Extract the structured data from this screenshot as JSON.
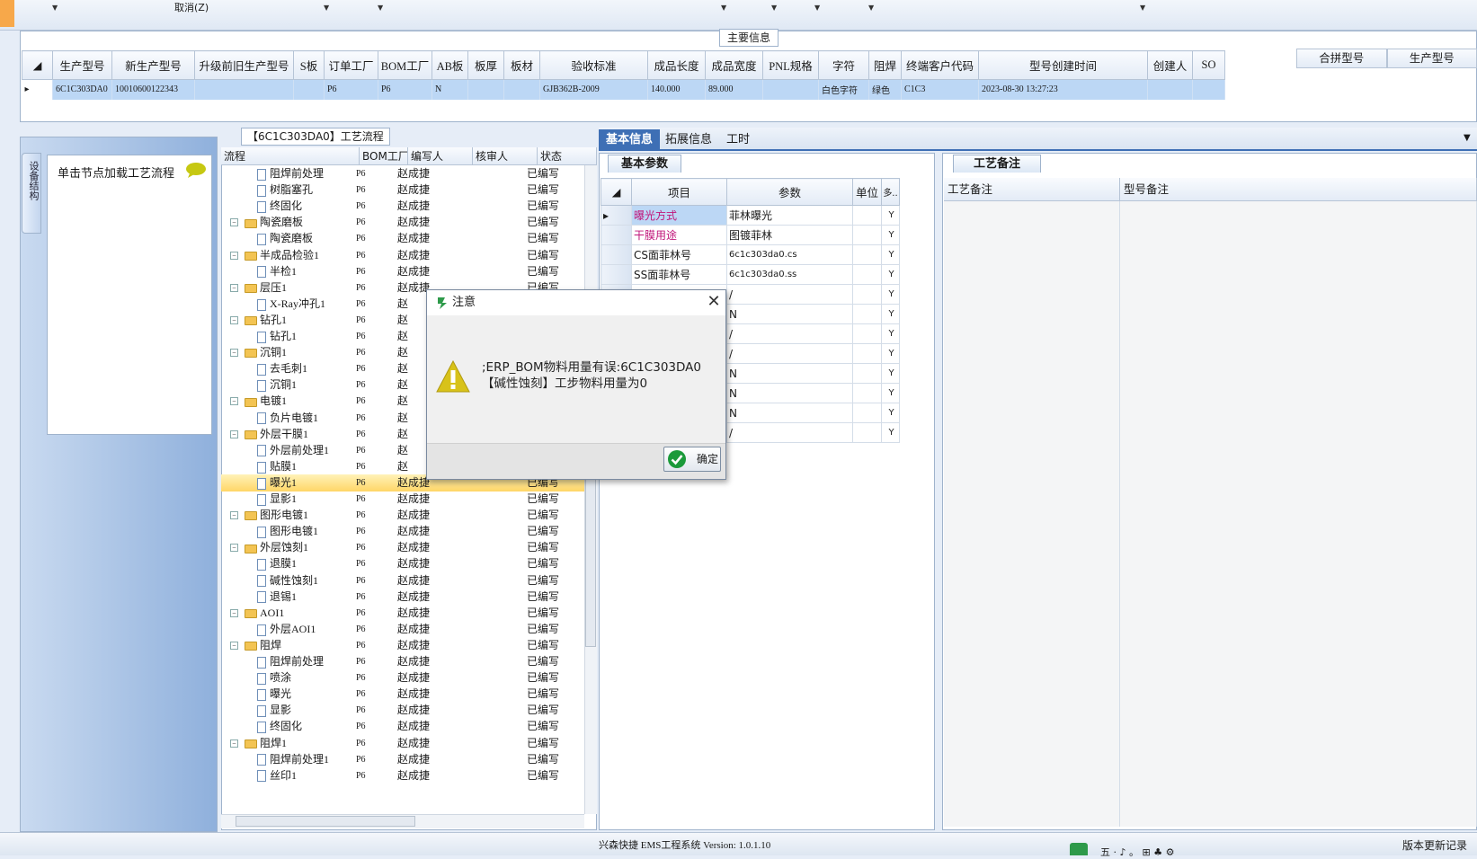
{
  "toolbar": {
    "cancel": "取消(Z)"
  },
  "main_info": {
    "title": "主要信息",
    "columns": [
      "生产型号",
      "新生产型号",
      "升级前旧生产型号",
      "S板",
      "订单工厂",
      "BOM工厂",
      "AB板",
      "板厚",
      "板材",
      "验收标准",
      "成品长度",
      "成品宽度",
      "PNL规格",
      "字符",
      "阻焊",
      "终端客户代码",
      "型号创建时间",
      "创建人",
      "SO"
    ],
    "row": [
      "6C1C303DA0",
      "10010600122343",
      "",
      "",
      "P6",
      "P6",
      "N",
      "",
      "",
      "GJB362B-2009",
      "140.000",
      "89.000",
      "",
      "白色字符",
      "绿色",
      "C1C3",
      "2023-08-30 13:27:23",
      "",
      ""
    ],
    "merge_columns": [
      "合拼型号",
      "生产型号"
    ]
  },
  "left_panel": {
    "vertical_tab": "设备结构",
    "load_label": "单击节点加载工艺流程"
  },
  "tree": {
    "title": "【6C1C303DA0】工艺流程",
    "columns": [
      "流程",
      "BOM工厂",
      "编写人",
      "核审人",
      "状态"
    ],
    "rows": [
      {
        "level": 2,
        "name": "阻焊前处理",
        "factory": "P6",
        "author": "赵成捷",
        "status": "已编写",
        "type": "file"
      },
      {
        "level": 2,
        "name": "树脂塞孔",
        "factory": "P6",
        "author": "赵成捷",
        "status": "已编写",
        "type": "file"
      },
      {
        "level": 2,
        "name": "终固化",
        "factory": "P6",
        "author": "赵成捷",
        "status": "已编写",
        "type": "file"
      },
      {
        "level": 1,
        "name": "陶瓷磨板",
        "factory": "P6",
        "author": "赵成捷",
        "status": "已编写",
        "type": "folder"
      },
      {
        "level": 2,
        "name": "陶瓷磨板",
        "factory": "P6",
        "author": "赵成捷",
        "status": "已编写",
        "type": "file"
      },
      {
        "level": 1,
        "name": "半成品检验1",
        "factory": "P6",
        "author": "赵成捷",
        "status": "已编写",
        "type": "folder"
      },
      {
        "level": 2,
        "name": "半检1",
        "factory": "P6",
        "author": "赵成捷",
        "status": "已编写",
        "type": "file"
      },
      {
        "level": 1,
        "name": "层压1",
        "factory": "P6",
        "author": "赵成捷",
        "status": "已编写",
        "type": "folder"
      },
      {
        "level": 2,
        "name": "X-Ray冲孔1",
        "factory": "P6",
        "author": "赵",
        "status": "",
        "type": "file"
      },
      {
        "level": 1,
        "name": "钻孔1",
        "factory": "P6",
        "author": "赵",
        "status": "",
        "type": "folder"
      },
      {
        "level": 2,
        "name": "钻孔1",
        "factory": "P6",
        "author": "赵",
        "status": "",
        "type": "file"
      },
      {
        "level": 1,
        "name": "沉铜1",
        "factory": "P6",
        "author": "赵",
        "status": "",
        "type": "folder"
      },
      {
        "level": 2,
        "name": "去毛刺1",
        "factory": "P6",
        "author": "赵",
        "status": "",
        "type": "file"
      },
      {
        "level": 2,
        "name": "沉铜1",
        "factory": "P6",
        "author": "赵",
        "status": "",
        "type": "file"
      },
      {
        "level": 1,
        "name": "电镀1",
        "factory": "P6",
        "author": "赵",
        "status": "",
        "type": "folder"
      },
      {
        "level": 2,
        "name": "负片电镀1",
        "factory": "P6",
        "author": "赵",
        "status": "",
        "type": "file"
      },
      {
        "level": 1,
        "name": "外层干膜1",
        "factory": "P6",
        "author": "赵",
        "status": "",
        "type": "folder"
      },
      {
        "level": 2,
        "name": "外层前处理1",
        "factory": "P6",
        "author": "赵",
        "status": "",
        "type": "file"
      },
      {
        "level": 2,
        "name": "贴膜1",
        "factory": "P6",
        "author": "赵",
        "status": "",
        "type": "file"
      },
      {
        "level": 2,
        "name": "曝光1",
        "factory": "P6",
        "author": "赵成捷",
        "status": "已编写",
        "type": "file",
        "selected": true
      },
      {
        "level": 2,
        "name": "显影1",
        "factory": "P6",
        "author": "赵成捷",
        "status": "已编写",
        "type": "file"
      },
      {
        "level": 1,
        "name": "图形电镀1",
        "factory": "P6",
        "author": "赵成捷",
        "status": "已编写",
        "type": "folder"
      },
      {
        "level": 2,
        "name": "图形电镀1",
        "factory": "P6",
        "author": "赵成捷",
        "status": "已编写",
        "type": "file"
      },
      {
        "level": 1,
        "name": "外层蚀刻1",
        "factory": "P6",
        "author": "赵成捷",
        "status": "已编写",
        "type": "folder"
      },
      {
        "level": 2,
        "name": "退膜1",
        "factory": "P6",
        "author": "赵成捷",
        "status": "已编写",
        "type": "file"
      },
      {
        "level": 2,
        "name": "碱性蚀刻1",
        "factory": "P6",
        "author": "赵成捷",
        "status": "已编写",
        "type": "file"
      },
      {
        "level": 2,
        "name": "退锡1",
        "factory": "P6",
        "author": "赵成捷",
        "status": "已编写",
        "type": "file"
      },
      {
        "level": 1,
        "name": "AOI1",
        "factory": "P6",
        "author": "赵成捷",
        "status": "已编写",
        "type": "folder"
      },
      {
        "level": 2,
        "name": "外层AOI1",
        "factory": "P6",
        "author": "赵成捷",
        "status": "已编写",
        "type": "file"
      },
      {
        "level": 1,
        "name": "阻焊",
        "factory": "P6",
        "author": "赵成捷",
        "status": "已编写",
        "type": "folder"
      },
      {
        "level": 2,
        "name": "阻焊前处理",
        "factory": "P6",
        "author": "赵成捷",
        "status": "已编写",
        "type": "file"
      },
      {
        "level": 2,
        "name": "喷涂",
        "factory": "P6",
        "author": "赵成捷",
        "status": "已编写",
        "type": "file"
      },
      {
        "level": 2,
        "name": "曝光",
        "factory": "P6",
        "author": "赵成捷",
        "status": "已编写",
        "type": "file"
      },
      {
        "level": 2,
        "name": "显影",
        "factory": "P6",
        "author": "赵成捷",
        "status": "已编写",
        "type": "file"
      },
      {
        "level": 2,
        "name": "终固化",
        "factory": "P6",
        "author": "赵成捷",
        "status": "已编写",
        "type": "file"
      },
      {
        "level": 1,
        "name": "阻焊1",
        "factory": "P6",
        "author": "赵成捷",
        "status": "已编写",
        "type": "folder"
      },
      {
        "level": 2,
        "name": "阻焊前处理1",
        "factory": "P6",
        "author": "赵成捷",
        "status": "已编写",
        "type": "file"
      },
      {
        "level": 2,
        "name": "丝印1",
        "factory": "P6",
        "author": "赵成捷",
        "status": "已编写",
        "type": "file"
      }
    ]
  },
  "right_tabs": [
    "基本信息",
    "拓展信息",
    "工时"
  ],
  "param_panel": {
    "tab": "基本参数",
    "columns": [
      "项目",
      "参数",
      "单位",
      "多.."
    ],
    "rows": [
      {
        "item": "曝光方式",
        "value": "菲林曝光",
        "unit": "",
        "multi": "Y",
        "color": "#c0157a"
      },
      {
        "item": "干膜用途",
        "value": "图镀菲林",
        "unit": "",
        "multi": "Y",
        "color": "#c0157a"
      },
      {
        "item": "CS面菲林号",
        "value": "6c1c303da0.cs",
        "unit": "",
        "multi": "Y",
        "color": "#1a1a1a"
      },
      {
        "item": "SS面菲林号",
        "value": "6c1c303da0.ss",
        "unit": "",
        "multi": "Y",
        "color": "#1a1a1a"
      },
      {
        "item": "",
        "value": "/",
        "unit": "",
        "multi": "Y",
        "color": "#1a1a1a"
      },
      {
        "item": "",
        "value": "N",
        "unit": "",
        "multi": "Y",
        "color": "#1a1a1a"
      },
      {
        "item": "",
        "value": "/",
        "unit": "",
        "multi": "Y",
        "color": "#1a1a1a"
      },
      {
        "item": "",
        "value": "/",
        "unit": "",
        "multi": "Y",
        "color": "#1a1a1a"
      },
      {
        "item": "",
        "value": "N",
        "unit": "",
        "multi": "Y",
        "color": "#1a1a1a"
      },
      {
        "item": "",
        "value": "N",
        "unit": "",
        "multi": "Y",
        "color": "#1a1a1a"
      },
      {
        "item": "",
        "value": "N",
        "unit": "",
        "multi": "Y",
        "color": "#1a1a1a"
      },
      {
        "item": "",
        "value": "/",
        "unit": "",
        "multi": "Y",
        "color": "#1a1a1a"
      }
    ]
  },
  "note_panel": {
    "tab": "工艺备注",
    "columns": [
      "工艺备注",
      "型号备注"
    ]
  },
  "dialog": {
    "title": "注意",
    "message": ";ERP_BOM物料用量有误:6C1C303DA0【碱性蚀刻】工步物料用量为0",
    "ok_label": "确定"
  },
  "status": {
    "app": "兴森快捷 EMS工程系统 Version: 1.0.1.10",
    "misc": "五 · ♪ 。 ⊞ ♣ ⚙",
    "right": "版本更新记录"
  }
}
